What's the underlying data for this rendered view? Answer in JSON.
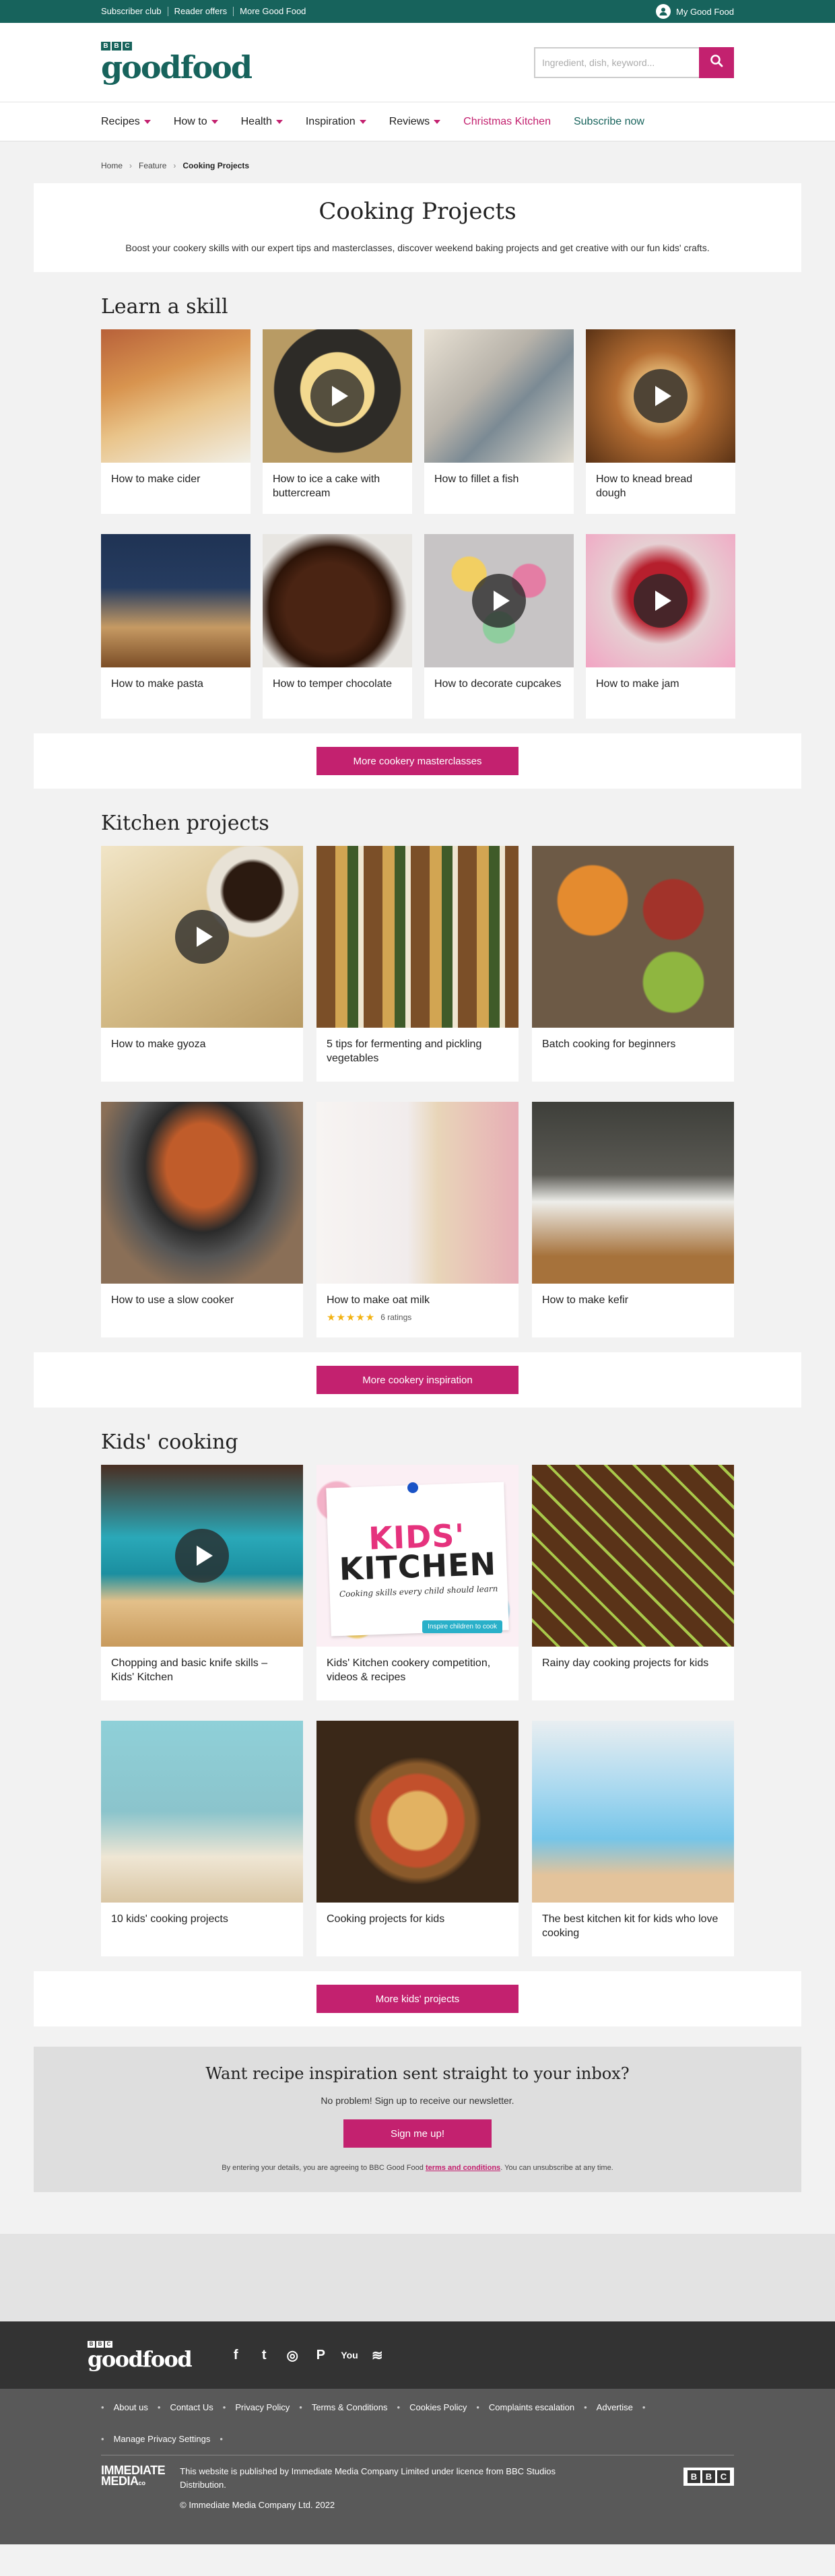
{
  "utility": {
    "links": [
      "Subscriber club",
      "Reader offers",
      "More Good Food"
    ],
    "account": "My Good Food"
  },
  "header": {
    "logo_bbc": [
      "B",
      "B",
      "C"
    ],
    "logo_word": "goodfood",
    "search_placeholder": "Ingredient, dish, keyword..."
  },
  "nav": {
    "items": [
      "Recipes",
      "How to",
      "Health",
      "Inspiration",
      "Reviews"
    ],
    "christmas": "Christmas Kitchen",
    "subscribe": "Subscribe now"
  },
  "breadcrumb": [
    "Home",
    "Feature",
    "Cooking Projects"
  ],
  "intro": {
    "title": "Cooking Projects",
    "description": "Boost your cookery skills with our expert tips and masterclasses, discover weekend baking projects and get creative with our fun kids' crafts."
  },
  "learn": {
    "title": "Learn a skill",
    "cards": [
      {
        "title": "How to make cider",
        "video": false
      },
      {
        "title": "How to ice a cake with buttercream",
        "video": true
      },
      {
        "title": "How to fillet a fish",
        "video": false
      },
      {
        "title": "How to knead bread dough",
        "video": true
      },
      {
        "title": "How to make pasta",
        "video": false
      },
      {
        "title": "How to temper chocolate",
        "video": false
      },
      {
        "title": "How to decorate cupcakes",
        "video": true
      },
      {
        "title": "How to make jam",
        "video": true
      }
    ],
    "more": "More cookery masterclasses"
  },
  "kitchen": {
    "title": "Kitchen projects",
    "cards": [
      {
        "title": "How to make gyoza",
        "video": true
      },
      {
        "title": "5 tips for fermenting and pickling vegetables",
        "video": false
      },
      {
        "title": "Batch cooking for beginners",
        "video": false
      },
      {
        "title": "How to use a slow cooker",
        "video": false
      },
      {
        "title": "How to make oat milk",
        "video": false,
        "stars": "★★★★★",
        "ratings": "6 ratings"
      },
      {
        "title": "How to make kefir",
        "video": false
      }
    ],
    "more": "More cookery inspiration"
  },
  "kids": {
    "title": "Kids' cooking",
    "cards": [
      {
        "title": "Chopping and basic knife skills – Kids' Kitchen",
        "video": true
      },
      {
        "title": "Kids' Kitchen cookery competition, videos & recipes",
        "video": false
      },
      {
        "title": "Rainy day cooking projects for kids",
        "video": false
      },
      {
        "title": "10 kids' cooking projects",
        "video": false
      },
      {
        "title": "Cooking projects for kids",
        "video": false
      },
      {
        "title": "The best kitchen kit for kids who love cooking",
        "video": false
      }
    ],
    "poster": {
      "line1": "KIDS'",
      "line2": "KITCHEN",
      "sub": "Cooking skills every child should learn",
      "tag": "Inspire children to cook"
    },
    "more": "More kids' projects"
  },
  "newsletter": {
    "title": "Want recipe inspiration sent straight to your inbox?",
    "lead": "No problem! Sign up to receive our newsletter.",
    "button": "Sign me up!",
    "fine_before": "By entering your details, you are agreeing to BBC Good Food ",
    "fine_link": "terms and conditions",
    "fine_after": ". You can unsubscribe at any time."
  },
  "footer": {
    "logo_word": "goodfood",
    "socials": [
      "facebook-icon",
      "twitter-icon",
      "instagram-icon",
      "pinterest-icon",
      "youtube-icon",
      "rss-icon"
    ],
    "social_glyphs": [
      "f",
      "t",
      "◎",
      "P",
      "You",
      "≋"
    ],
    "links": [
      "About us",
      "Contact Us",
      "Privacy Policy",
      "Terms & Conditions",
      "Cookies Policy",
      "Complaints escalation",
      "Advertise",
      "Manage Privacy Settings"
    ],
    "immediate_line1": "IMMEDIATE",
    "immediate_line2": "MEDIA",
    "immediate_co": "co",
    "publisher": "This website is published by Immediate Media Company Limited under licence from BBC Studios Distribution.",
    "copyright": "© Immediate Media Company Ltd. 2022",
    "bbc": [
      "B",
      "B",
      "C"
    ]
  },
  "colors": {
    "brand_green": "#17635c",
    "accent_pink": "#c3216f",
    "star_gold": "#f2b213"
  }
}
